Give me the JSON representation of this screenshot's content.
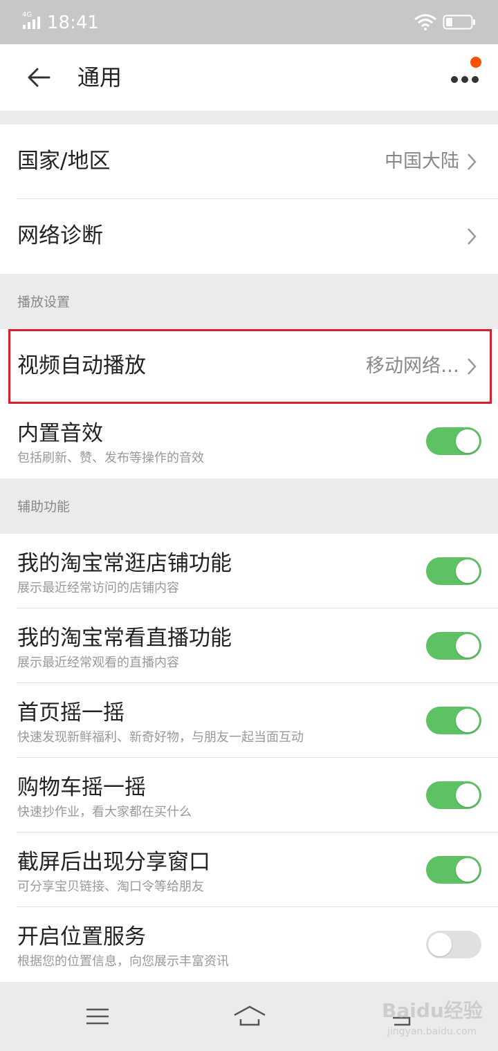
{
  "status_bar": {
    "network": "4G",
    "time": "18:41"
  },
  "app_bar": {
    "title": "通用"
  },
  "region_group": [
    {
      "title": "国家/地区",
      "value": "中国大陆"
    },
    {
      "title": "网络诊断",
      "value": ""
    }
  ],
  "playback_section": {
    "label": "播放设置",
    "autoplay": {
      "title": "视频自动播放",
      "value": "移动网络…"
    },
    "sound": {
      "title": "内置音效",
      "subtitle": "包括刷新、赞、发布等操作的音效",
      "enabled": true
    }
  },
  "assist_section": {
    "label": "辅助功能",
    "items": [
      {
        "title": "我的淘宝常逛店铺功能",
        "subtitle": "展示最近经常访问的店铺内容",
        "enabled": true
      },
      {
        "title": "我的淘宝常看直播功能",
        "subtitle": "展示最近经常观看的直播内容",
        "enabled": true
      },
      {
        "title": "首页摇一摇",
        "subtitle": "快速发现新鲜福利、新奇好物，与朋友一起当面互动",
        "enabled": true
      },
      {
        "title": "购物车摇一摇",
        "subtitle": "快速抄作业，看大家都在买什么",
        "enabled": true
      },
      {
        "title": "截屏后出现分享窗口",
        "subtitle": "可分享宝贝链接、淘口令等给朋友",
        "enabled": true
      },
      {
        "title": "开启位置服务",
        "subtitle": "根据您的位置信息，向您展示丰富资讯",
        "enabled": false
      }
    ]
  },
  "watermark": {
    "text": "Baidu经验",
    "sub": "jingyan.baidu.com"
  },
  "colors": {
    "toggle_on": "#5dc264",
    "toggle_off": "#e0e0e0",
    "badge": "#ff5000",
    "highlight": "#d7222d"
  }
}
